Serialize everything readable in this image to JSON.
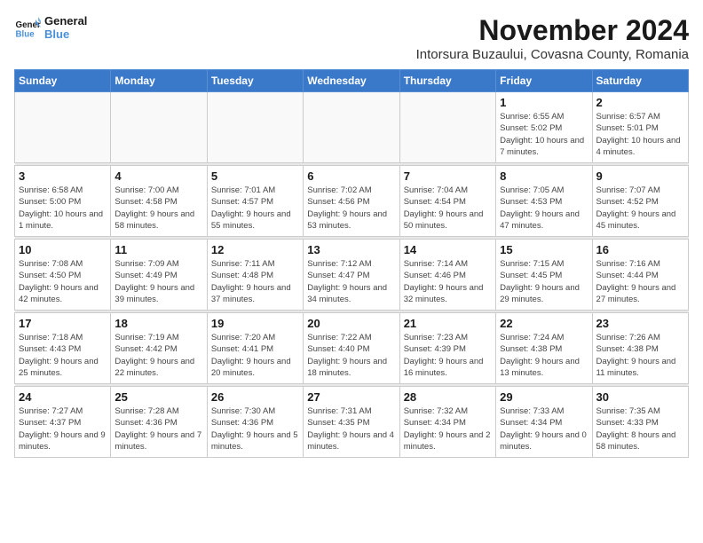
{
  "logo": {
    "line1": "General",
    "line2": "Blue"
  },
  "title": "November 2024",
  "subtitle": "Intorsura Buzaului, Covasna County, Romania",
  "weekdays": [
    "Sunday",
    "Monday",
    "Tuesday",
    "Wednesday",
    "Thursday",
    "Friday",
    "Saturday"
  ],
  "weeks": [
    [
      {
        "day": "",
        "info": ""
      },
      {
        "day": "",
        "info": ""
      },
      {
        "day": "",
        "info": ""
      },
      {
        "day": "",
        "info": ""
      },
      {
        "day": "",
        "info": ""
      },
      {
        "day": "1",
        "info": "Sunrise: 6:55 AM\nSunset: 5:02 PM\nDaylight: 10 hours and 7 minutes."
      },
      {
        "day": "2",
        "info": "Sunrise: 6:57 AM\nSunset: 5:01 PM\nDaylight: 10 hours and 4 minutes."
      }
    ],
    [
      {
        "day": "3",
        "info": "Sunrise: 6:58 AM\nSunset: 5:00 PM\nDaylight: 10 hours and 1 minute."
      },
      {
        "day": "4",
        "info": "Sunrise: 7:00 AM\nSunset: 4:58 PM\nDaylight: 9 hours and 58 minutes."
      },
      {
        "day": "5",
        "info": "Sunrise: 7:01 AM\nSunset: 4:57 PM\nDaylight: 9 hours and 55 minutes."
      },
      {
        "day": "6",
        "info": "Sunrise: 7:02 AM\nSunset: 4:56 PM\nDaylight: 9 hours and 53 minutes."
      },
      {
        "day": "7",
        "info": "Sunrise: 7:04 AM\nSunset: 4:54 PM\nDaylight: 9 hours and 50 minutes."
      },
      {
        "day": "8",
        "info": "Sunrise: 7:05 AM\nSunset: 4:53 PM\nDaylight: 9 hours and 47 minutes."
      },
      {
        "day": "9",
        "info": "Sunrise: 7:07 AM\nSunset: 4:52 PM\nDaylight: 9 hours and 45 minutes."
      }
    ],
    [
      {
        "day": "10",
        "info": "Sunrise: 7:08 AM\nSunset: 4:50 PM\nDaylight: 9 hours and 42 minutes."
      },
      {
        "day": "11",
        "info": "Sunrise: 7:09 AM\nSunset: 4:49 PM\nDaylight: 9 hours and 39 minutes."
      },
      {
        "day": "12",
        "info": "Sunrise: 7:11 AM\nSunset: 4:48 PM\nDaylight: 9 hours and 37 minutes."
      },
      {
        "day": "13",
        "info": "Sunrise: 7:12 AM\nSunset: 4:47 PM\nDaylight: 9 hours and 34 minutes."
      },
      {
        "day": "14",
        "info": "Sunrise: 7:14 AM\nSunset: 4:46 PM\nDaylight: 9 hours and 32 minutes."
      },
      {
        "day": "15",
        "info": "Sunrise: 7:15 AM\nSunset: 4:45 PM\nDaylight: 9 hours and 29 minutes."
      },
      {
        "day": "16",
        "info": "Sunrise: 7:16 AM\nSunset: 4:44 PM\nDaylight: 9 hours and 27 minutes."
      }
    ],
    [
      {
        "day": "17",
        "info": "Sunrise: 7:18 AM\nSunset: 4:43 PM\nDaylight: 9 hours and 25 minutes."
      },
      {
        "day": "18",
        "info": "Sunrise: 7:19 AM\nSunset: 4:42 PM\nDaylight: 9 hours and 22 minutes."
      },
      {
        "day": "19",
        "info": "Sunrise: 7:20 AM\nSunset: 4:41 PM\nDaylight: 9 hours and 20 minutes."
      },
      {
        "day": "20",
        "info": "Sunrise: 7:22 AM\nSunset: 4:40 PM\nDaylight: 9 hours and 18 minutes."
      },
      {
        "day": "21",
        "info": "Sunrise: 7:23 AM\nSunset: 4:39 PM\nDaylight: 9 hours and 16 minutes."
      },
      {
        "day": "22",
        "info": "Sunrise: 7:24 AM\nSunset: 4:38 PM\nDaylight: 9 hours and 13 minutes."
      },
      {
        "day": "23",
        "info": "Sunrise: 7:26 AM\nSunset: 4:38 PM\nDaylight: 9 hours and 11 minutes."
      }
    ],
    [
      {
        "day": "24",
        "info": "Sunrise: 7:27 AM\nSunset: 4:37 PM\nDaylight: 9 hours and 9 minutes."
      },
      {
        "day": "25",
        "info": "Sunrise: 7:28 AM\nSunset: 4:36 PM\nDaylight: 9 hours and 7 minutes."
      },
      {
        "day": "26",
        "info": "Sunrise: 7:30 AM\nSunset: 4:36 PM\nDaylight: 9 hours and 5 minutes."
      },
      {
        "day": "27",
        "info": "Sunrise: 7:31 AM\nSunset: 4:35 PM\nDaylight: 9 hours and 4 minutes."
      },
      {
        "day": "28",
        "info": "Sunrise: 7:32 AM\nSunset: 4:34 PM\nDaylight: 9 hours and 2 minutes."
      },
      {
        "day": "29",
        "info": "Sunrise: 7:33 AM\nSunset: 4:34 PM\nDaylight: 9 hours and 0 minutes."
      },
      {
        "day": "30",
        "info": "Sunrise: 7:35 AM\nSunset: 4:33 PM\nDaylight: 8 hours and 58 minutes."
      }
    ]
  ]
}
